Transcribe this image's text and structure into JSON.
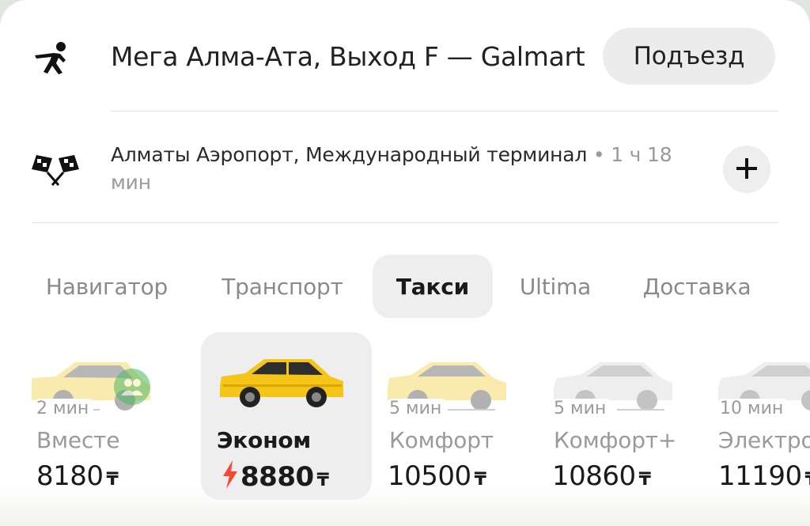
{
  "route": {
    "pickup": {
      "icon": "walking-person-icon",
      "address": "Мега Алма-Ата, Выход F — Galmart",
      "entrance_button": "Подъезд"
    },
    "destination": {
      "icon": "checkered-flags-icon",
      "address": "Алматы Аэропорт, Международный терминал",
      "separator": " • ",
      "duration": "1 ч 18 мин",
      "add_stop_icon": "plus-icon"
    }
  },
  "tabs": [
    {
      "label": "Навигатор",
      "active": false
    },
    {
      "label": "Транспорт",
      "active": false
    },
    {
      "label": "Такси",
      "active": true
    },
    {
      "label": "Ultima",
      "active": false
    },
    {
      "label": "Доставка",
      "active": false
    }
  ],
  "tariffs": [
    {
      "name": "Вместе",
      "eta": "2 мин",
      "price": "8180",
      "currency": "₸",
      "badge_icon": "people-icon",
      "car_color": "#f2c74b",
      "selected": false
    },
    {
      "name": "Эконом",
      "eta": "",
      "price": "8880",
      "currency": "₸",
      "surge_icon": "lightning-icon",
      "car_color": "#f5c518",
      "selected": true
    },
    {
      "name": "Комфорт",
      "eta": "5 мин",
      "price": "10500",
      "currency": "₸",
      "car_color": "#f2c74b",
      "selected": false
    },
    {
      "name": "Комфорт+",
      "eta": "5 мин",
      "price": "10860",
      "currency": "₸",
      "car_color": "#e6e6e6",
      "selected": false
    },
    {
      "name": "Электро",
      "eta": "10 мин",
      "price": "11190",
      "currency": "₸",
      "car_color": "#e6e6e6",
      "selected": false
    }
  ],
  "colors": {
    "accent_yellow": "#f5c518",
    "surge_red": "#ff4433",
    "badge_green": "#4cb861"
  }
}
